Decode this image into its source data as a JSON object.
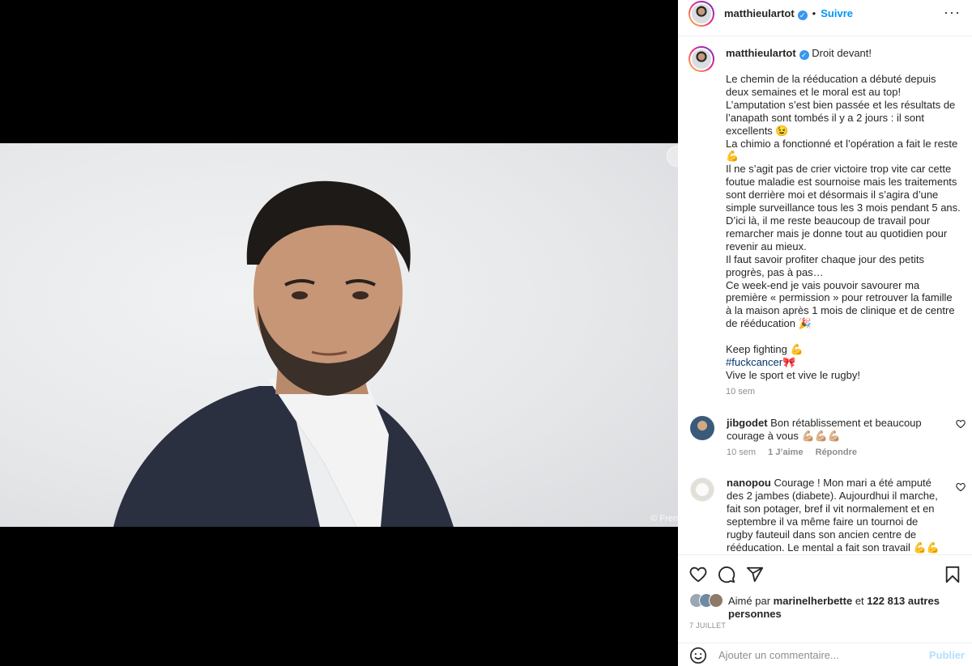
{
  "post": {
    "photo_credit": "© Fren",
    "author": "matthieulartot",
    "follow_label": "Suivre",
    "dot": "•",
    "caption_title": "Droit devant!",
    "caption_text": "Le chemin de la rééducation a débuté depuis deux semaines et le moral est au top!\nL’amputation s’est bien passée et les résultats de l’anapath sont tombés il y a 2 jours : il sont excellents 😉\nLa chimio a fonctionné et l’opération a fait le reste 💪\nIl ne s’agit pas de crier victoire trop vite car cette foutue maladie est sournoise mais les traitements sont derrière moi et désormais il s’agira d’une simple surveillance tous les 3 mois pendant 5 ans.\nD’ici là, il me reste beaucoup de travail pour remarcher mais je donne tout au quotidien pour revenir au mieux.\nIl faut savoir profiter chaque jour des petits progrès, pas à pas…\nCe week-end je vais pouvoir savourer ma première « permission » pour retrouver la famille à la maison après 1 mois de clinique et de centre de rééducation 🎉\n\nKeep fighting 💪",
    "hashtag": "#fuckcancer🎀",
    "caption_end": "Vive le sport et vive le rugby!",
    "caption_time": "10 sem"
  },
  "comments": [
    {
      "user": "jibgodet",
      "text": "Bon rétablissement et beaucoup courage à vous 💪🏼💪🏼💪🏼",
      "time": "10 sem",
      "likes": "1 J’aime",
      "reply": "Répondre",
      "avatar_color": "#3a5a7a"
    },
    {
      "user": "nanopou",
      "text": "Courage ! Mon mari a été amputé des 2 jambes (diabete). Aujourdhui il marche, fait son potager, bref il vit normalement et en septembre il va même faire un tournoi de rugby fauteuil dans son ancien centre de rééducation. Le mental a fait son travail 💪💪 . Force a vous",
      "avatar_color": "#e9e7e2"
    }
  ],
  "likes": {
    "prefix": "Aimé par",
    "user": "marinelherbette",
    "middle": "et",
    "count": "122 813 autres personnes"
  },
  "date": "7 JUILLET",
  "comment_box": {
    "placeholder": "Ajouter un commentaire...",
    "publish": "Publier"
  }
}
